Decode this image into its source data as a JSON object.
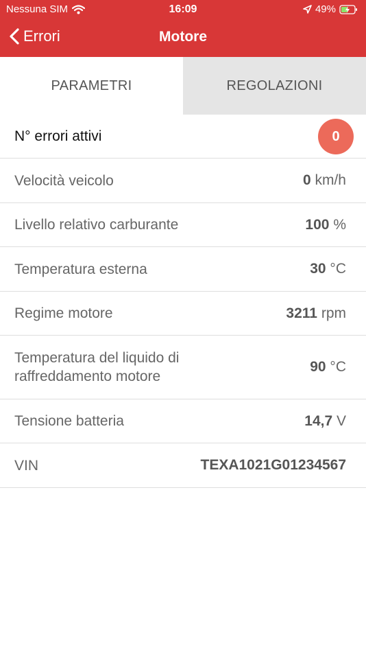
{
  "status_bar": {
    "carrier": "Nessuna SIM",
    "time": "16:09",
    "battery": "49%"
  },
  "nav": {
    "back_label": "Errori",
    "title": "Motore"
  },
  "tabs": [
    {
      "label": "PARAMETRI",
      "active": true
    },
    {
      "label": "REGOLAZIONI",
      "active": false
    }
  ],
  "active_errors": {
    "label": "N° errori attivi",
    "count": "0"
  },
  "params": [
    {
      "label": "Velocità veicolo",
      "value": "0",
      "unit": "km/h"
    },
    {
      "label": "Livello relativo carburante",
      "value": "100",
      "unit": "%"
    },
    {
      "label": "Temperatura esterna",
      "value": "30",
      "unit": "°C"
    },
    {
      "label": "Regime motore",
      "value": "3211",
      "unit": "rpm"
    },
    {
      "label": "Temperatura del liquido di raffreddamento motore",
      "value": "90",
      "unit": "°C"
    },
    {
      "label": "Tensione batteria",
      "value": "14,7",
      "unit": "V"
    },
    {
      "label": "VIN",
      "value": "TEXA1021G01234567",
      "unit": ""
    }
  ],
  "colors": {
    "header": "#d83737",
    "badge": "#ec6a5a",
    "inactive_tab": "#e5e5e5"
  }
}
